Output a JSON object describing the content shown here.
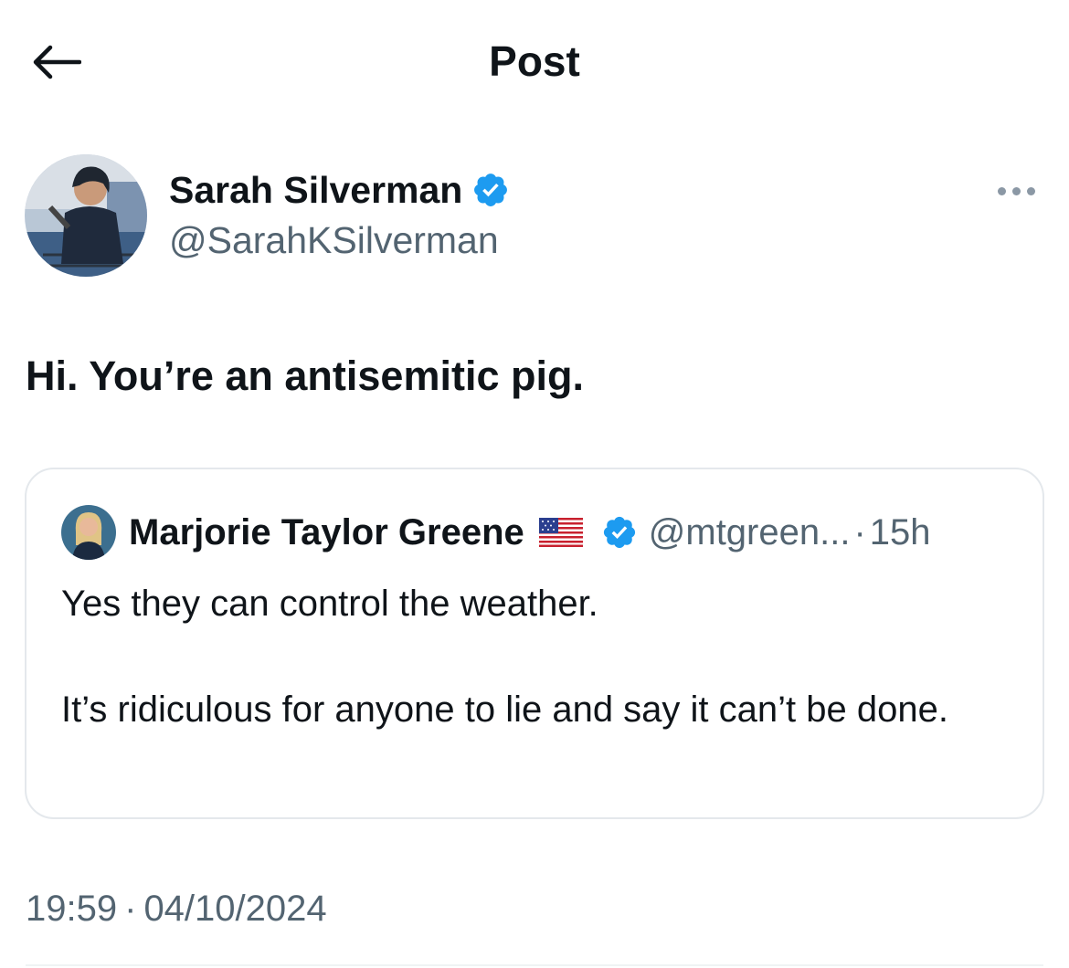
{
  "header": {
    "title": "Post",
    "back_icon": "arrow-left-icon"
  },
  "post": {
    "author": {
      "name": "Sarah Silverman",
      "handle": "@SarahKSilverman",
      "verified": true
    },
    "more_icon": "more-horizontal-icon",
    "text": "Hi. You’re an antisemitic pig.",
    "time": "19:59",
    "separator": "·",
    "date": "04/10/2024"
  },
  "quote": {
    "author": {
      "name": "Marjorie Taylor Greene",
      "flag_icon": "us-flag-icon",
      "verified": true,
      "handle": "@mtgreen...",
      "separator": "·",
      "age": "15h"
    },
    "paragraphs": [
      "Yes they can control the weather.",
      "It’s ridiculous for anyone to lie and say it can’t be done."
    ]
  },
  "colors": {
    "text": "#0f1419",
    "secondary": "#536471",
    "verified": "#1d9bf0",
    "border": "#e4e8ec"
  }
}
